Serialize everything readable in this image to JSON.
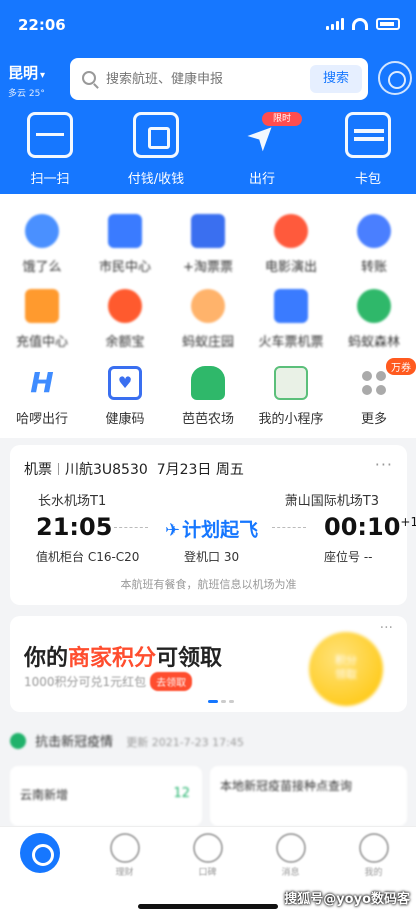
{
  "status_bar": {
    "time": "22:06"
  },
  "header": {
    "city": "昆明",
    "city_sub": "多云 25°",
    "search_placeholder": "搜索航班、健康申报",
    "search_button": "搜索",
    "quick_actions": [
      {
        "label": "扫一扫",
        "icon": "scan-icon"
      },
      {
        "label": "付钱/收钱",
        "icon": "pay-icon"
      },
      {
        "label": "出行",
        "icon": "travel-icon",
        "badge": "限时"
      },
      {
        "label": "卡包",
        "icon": "card-icon"
      }
    ]
  },
  "grid": {
    "row1": [
      {
        "label": "饿了么",
        "icon": "eleme-icon",
        "color": "#4a90ff"
      },
      {
        "label": "市民中心",
        "icon": "citizen-icon",
        "color": "#3a7bff"
      },
      {
        "label": "+淘票票",
        "icon": "ticket-icon",
        "color": "#3a6ff0"
      },
      {
        "label": "电影演出",
        "icon": "movie-icon",
        "color": "#ff5a3c"
      },
      {
        "label": "转账",
        "icon": "transfer-icon",
        "color": "#4a7fff"
      }
    ],
    "row2": [
      {
        "label": "充值中心",
        "icon": "recharge-icon",
        "color": "#ff9a2e"
      },
      {
        "label": "余额宝",
        "icon": "yuebao-icon",
        "color": "#ff5a2e"
      },
      {
        "label": "蚂蚁庄园",
        "icon": "manor-icon",
        "color": "#ffb36b"
      },
      {
        "label": "火车票机票",
        "icon": "train-icon",
        "color": "#3a7bff"
      },
      {
        "label": "蚂蚁森林",
        "icon": "forest-icon",
        "color": "#2fb86a"
      }
    ],
    "row3": [
      {
        "label": "哈啰出行",
        "icon": "hello-bike-icon",
        "color": "#3f8cff"
      },
      {
        "label": "健康码",
        "icon": "health-code-icon",
        "color": "#3a6ff0"
      },
      {
        "label": "芭芭农场",
        "icon": "farm-icon",
        "color": "#2fb86a"
      },
      {
        "label": "我的小程序",
        "icon": "miniapp-icon",
        "color": "#5bbf7a"
      },
      {
        "label": "更多",
        "icon": "more-icon",
        "color": "#999999",
        "badge": "万券"
      }
    ]
  },
  "flight": {
    "type": "机票",
    "flight_no": "川航3U8530",
    "date": "7月23日 周五",
    "from_airport": "长水机场T1",
    "to_airport": "萧山国际机场T3",
    "dep_time": "21:05",
    "arr_time": "00:10",
    "arr_day": "+1",
    "status": "计划起飞",
    "counter": "值机柜台 C16-C20",
    "gate": "登机口 30",
    "seat": "座位号 --",
    "note": "本航班有餐食，航班信息以机场为准"
  },
  "promo": {
    "title_prefix": "你的",
    "title_highlight": "商家积分",
    "title_suffix": "可领取",
    "subtitle": "1000积分可兑1元红包",
    "pill": "去领取",
    "coin_text": "积分\n领取"
  },
  "covid": {
    "title": "抗击新冠疫情",
    "date": "更新 2021-7-23 17:45",
    "card1_text": "云南新增",
    "card1_num": "12",
    "card2_text": "本地新冠疫苗接种点查询"
  },
  "tabbar": [
    {
      "label": "首页",
      "icon": "home-icon"
    },
    {
      "label": "理财",
      "icon": "wealth-icon"
    },
    {
      "label": "口碑",
      "icon": "koubei-icon"
    },
    {
      "label": "消息",
      "icon": "message-icon"
    },
    {
      "label": "我的",
      "icon": "profile-icon"
    }
  ],
  "watermark": "搜狐号@yoyo数码客",
  "colors": {
    "brand": "#1677ff",
    "accent": "#ff4d2e",
    "green": "#20b26b"
  }
}
